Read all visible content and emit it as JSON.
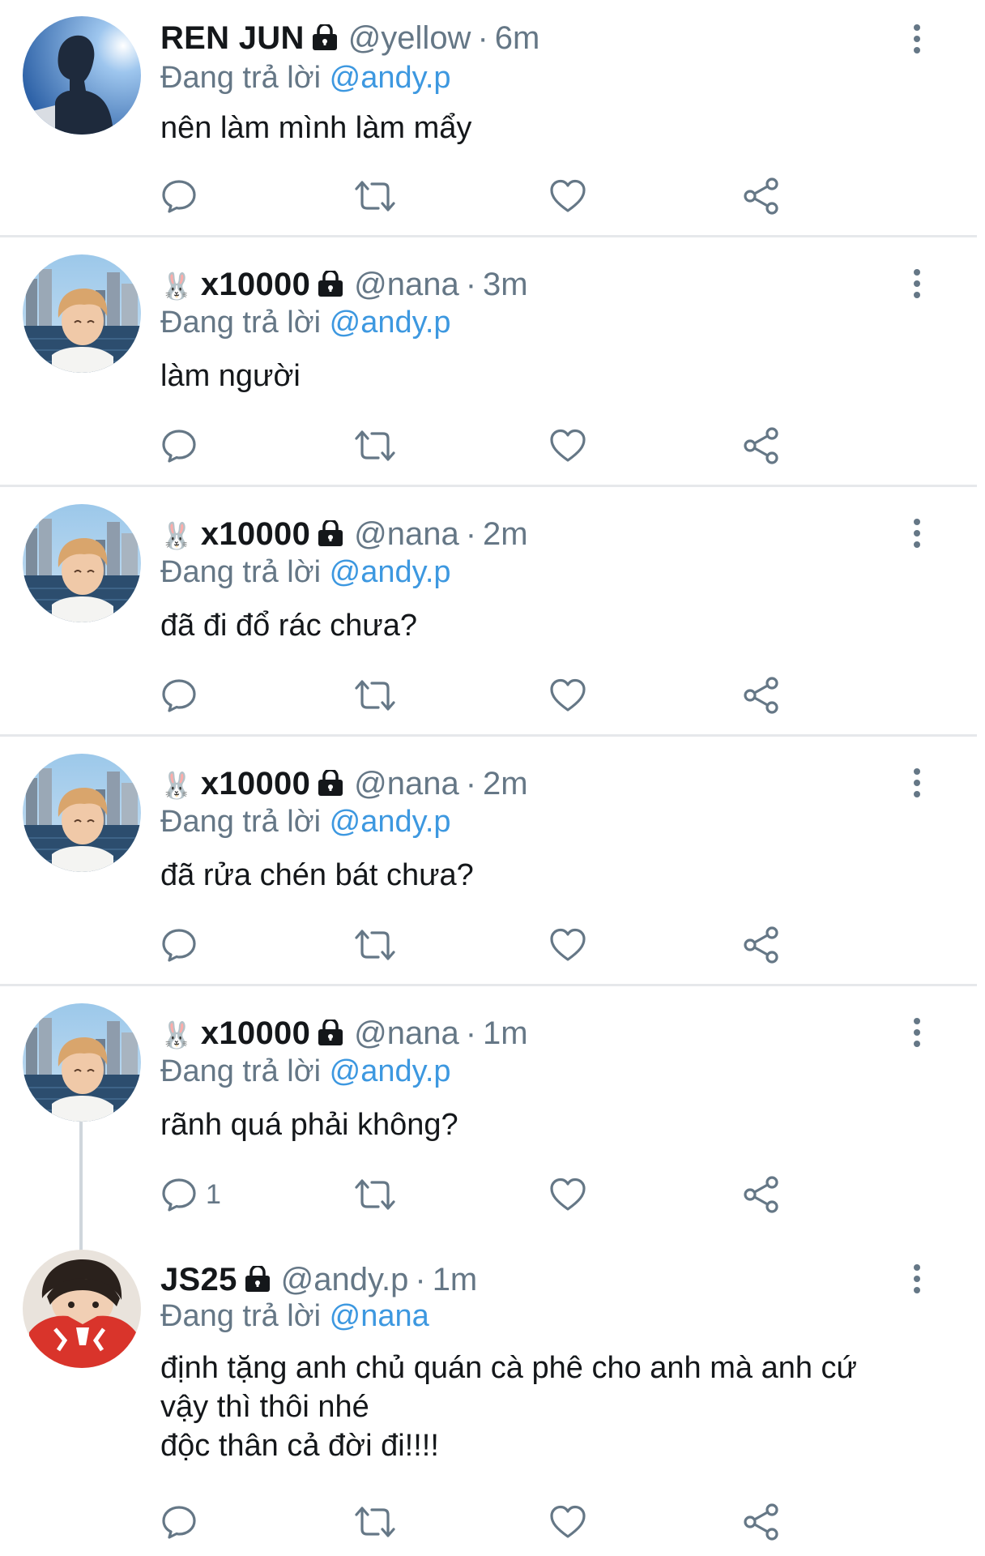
{
  "tweets": [
    {
      "emoji": "",
      "name": "REN JUN",
      "handle": "@yellow",
      "time": "6m",
      "reply_prefix": "Đang trả lời",
      "reply_to": "@andy.p",
      "lines": [
        "nên làm mình làm mẩy"
      ],
      "reply_count": "",
      "avatar": "blue-sky-profile-photo"
    },
    {
      "emoji": "🐰",
      "name": "x10000",
      "handle": "@nana",
      "time": "3m",
      "reply_prefix": "Đang trả lời",
      "reply_to": "@andy.p",
      "lines": [
        "làm người"
      ],
      "reply_count": "",
      "avatar": "city-river-selfie-photo"
    },
    {
      "emoji": "🐰",
      "name": "x10000",
      "handle": "@nana",
      "time": "2m",
      "reply_prefix": "Đang trả lời",
      "reply_to": "@andy.p",
      "lines": [
        "đã đi đổ rác chưa?"
      ],
      "reply_count": "",
      "avatar": "city-river-selfie-photo"
    },
    {
      "emoji": "🐰",
      "name": "x10000",
      "handle": "@nana",
      "time": "2m",
      "reply_prefix": "Đang trả lời",
      "reply_to": "@andy.p",
      "lines": [
        "đã rửa chén bát chưa?"
      ],
      "reply_count": "",
      "avatar": "city-river-selfie-photo"
    },
    {
      "emoji": "🐰",
      "name": "x10000",
      "handle": "@nana",
      "time": "1m",
      "reply_prefix": "Đang trả lời",
      "reply_to": "@andy.p",
      "lines": [
        "rãnh quá phải không?"
      ],
      "reply_count": "1",
      "avatar": "city-river-selfie-photo"
    },
    {
      "emoji": "",
      "name": "JS25",
      "handle": "@andy.p",
      "time": "1m",
      "reply_prefix": "Đang trả lời",
      "reply_to": "@nana",
      "lines": [
        "định tặng anh chủ quán cà phê cho anh mà anh cứ",
        "vậy thì thôi nhé",
        "độc thân cả đời đi!!!!"
      ],
      "reply_count": "",
      "avatar": "red-shirt-selfie-photo"
    }
  ],
  "icons": {
    "reply": "speech-bubble-icon",
    "retweet": "retweet-icon",
    "like": "heart-icon",
    "share": "share-icon",
    "more": "more-vertical-icon",
    "lock": "lock-icon"
  },
  "colors": {
    "mention": "#3d98e0",
    "secondary_text": "#657786",
    "icon": "#657786",
    "separator": "#e6e8eb"
  }
}
